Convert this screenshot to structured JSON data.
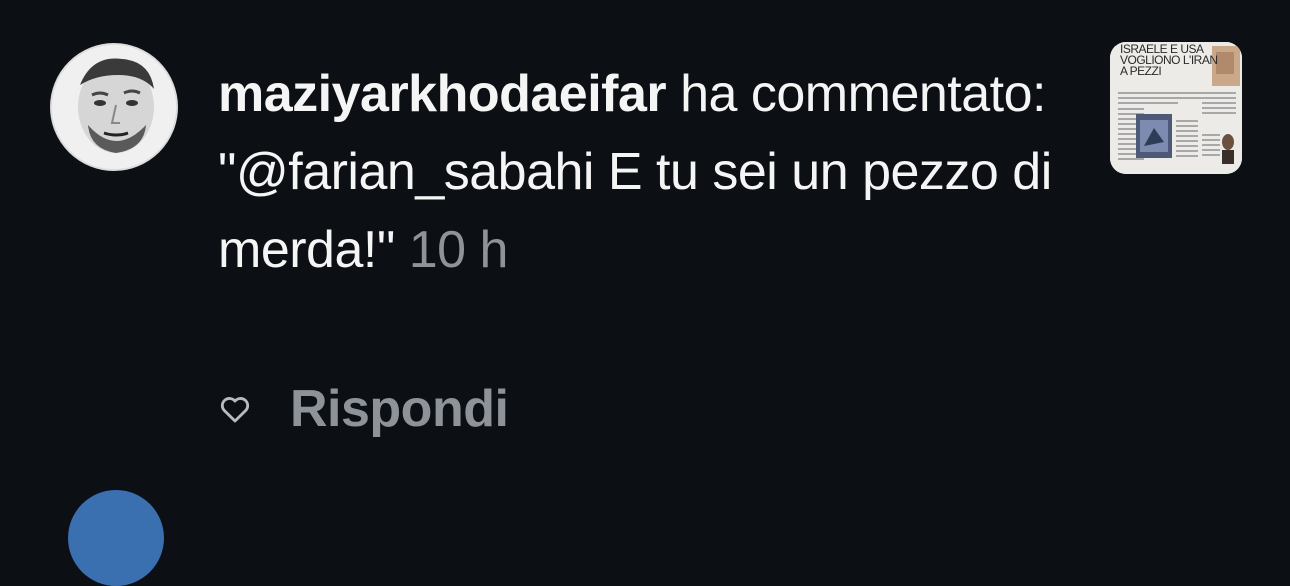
{
  "notification": {
    "username": "maziyarkhodaeifar",
    "action_text": " ha commentato: ",
    "comment": "\"@farian_sabahi E tu sei un pezzo di merda!\"",
    "time": "10 h"
  },
  "actions": {
    "like_icon": "heart-outline-icon",
    "reply_label": "Rispondi"
  },
  "thumbnail": {
    "headline": "Israele e USA vogliono l'Iran a pezzi"
  },
  "colors": {
    "background": "#0c1014",
    "text_primary": "#f5f5f5",
    "text_secondary": "#8e939a"
  }
}
